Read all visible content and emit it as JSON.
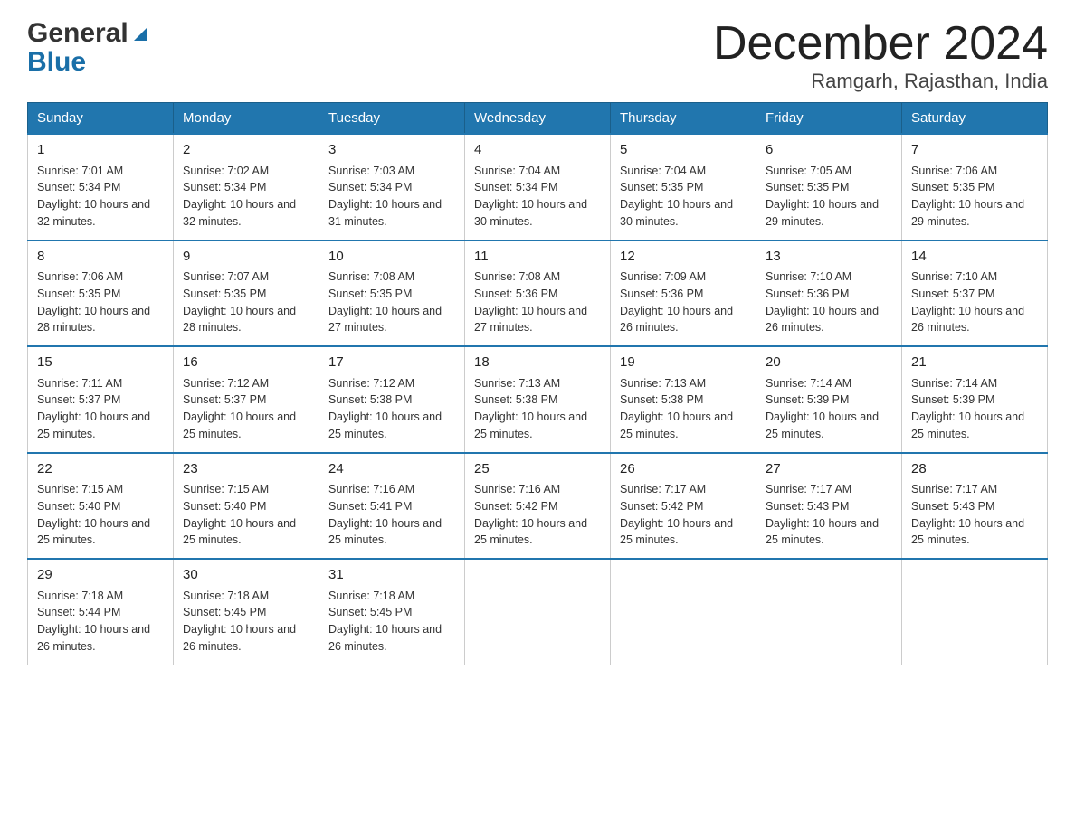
{
  "header": {
    "logo_general": "General",
    "logo_blue": "Blue",
    "title": "December 2024",
    "subtitle": "Ramgarh, Rajasthan, India"
  },
  "weekdays": [
    "Sunday",
    "Monday",
    "Tuesday",
    "Wednesday",
    "Thursday",
    "Friday",
    "Saturday"
  ],
  "weeks": [
    [
      {
        "day": "1",
        "sunrise": "7:01 AM",
        "sunset": "5:34 PM",
        "daylight": "10 hours and 32 minutes."
      },
      {
        "day": "2",
        "sunrise": "7:02 AM",
        "sunset": "5:34 PM",
        "daylight": "10 hours and 32 minutes."
      },
      {
        "day": "3",
        "sunrise": "7:03 AM",
        "sunset": "5:34 PM",
        "daylight": "10 hours and 31 minutes."
      },
      {
        "day": "4",
        "sunrise": "7:04 AM",
        "sunset": "5:34 PM",
        "daylight": "10 hours and 30 minutes."
      },
      {
        "day": "5",
        "sunrise": "7:04 AM",
        "sunset": "5:35 PM",
        "daylight": "10 hours and 30 minutes."
      },
      {
        "day": "6",
        "sunrise": "7:05 AM",
        "sunset": "5:35 PM",
        "daylight": "10 hours and 29 minutes."
      },
      {
        "day": "7",
        "sunrise": "7:06 AM",
        "sunset": "5:35 PM",
        "daylight": "10 hours and 29 minutes."
      }
    ],
    [
      {
        "day": "8",
        "sunrise": "7:06 AM",
        "sunset": "5:35 PM",
        "daylight": "10 hours and 28 minutes."
      },
      {
        "day": "9",
        "sunrise": "7:07 AM",
        "sunset": "5:35 PM",
        "daylight": "10 hours and 28 minutes."
      },
      {
        "day": "10",
        "sunrise": "7:08 AM",
        "sunset": "5:35 PM",
        "daylight": "10 hours and 27 minutes."
      },
      {
        "day": "11",
        "sunrise": "7:08 AM",
        "sunset": "5:36 PM",
        "daylight": "10 hours and 27 minutes."
      },
      {
        "day": "12",
        "sunrise": "7:09 AM",
        "sunset": "5:36 PM",
        "daylight": "10 hours and 26 minutes."
      },
      {
        "day": "13",
        "sunrise": "7:10 AM",
        "sunset": "5:36 PM",
        "daylight": "10 hours and 26 minutes."
      },
      {
        "day": "14",
        "sunrise": "7:10 AM",
        "sunset": "5:37 PM",
        "daylight": "10 hours and 26 minutes."
      }
    ],
    [
      {
        "day": "15",
        "sunrise": "7:11 AM",
        "sunset": "5:37 PM",
        "daylight": "10 hours and 25 minutes."
      },
      {
        "day": "16",
        "sunrise": "7:12 AM",
        "sunset": "5:37 PM",
        "daylight": "10 hours and 25 minutes."
      },
      {
        "day": "17",
        "sunrise": "7:12 AM",
        "sunset": "5:38 PM",
        "daylight": "10 hours and 25 minutes."
      },
      {
        "day": "18",
        "sunrise": "7:13 AM",
        "sunset": "5:38 PM",
        "daylight": "10 hours and 25 minutes."
      },
      {
        "day": "19",
        "sunrise": "7:13 AM",
        "sunset": "5:38 PM",
        "daylight": "10 hours and 25 minutes."
      },
      {
        "day": "20",
        "sunrise": "7:14 AM",
        "sunset": "5:39 PM",
        "daylight": "10 hours and 25 minutes."
      },
      {
        "day": "21",
        "sunrise": "7:14 AM",
        "sunset": "5:39 PM",
        "daylight": "10 hours and 25 minutes."
      }
    ],
    [
      {
        "day": "22",
        "sunrise": "7:15 AM",
        "sunset": "5:40 PM",
        "daylight": "10 hours and 25 minutes."
      },
      {
        "day": "23",
        "sunrise": "7:15 AM",
        "sunset": "5:40 PM",
        "daylight": "10 hours and 25 minutes."
      },
      {
        "day": "24",
        "sunrise": "7:16 AM",
        "sunset": "5:41 PM",
        "daylight": "10 hours and 25 minutes."
      },
      {
        "day": "25",
        "sunrise": "7:16 AM",
        "sunset": "5:42 PM",
        "daylight": "10 hours and 25 minutes."
      },
      {
        "day": "26",
        "sunrise": "7:17 AM",
        "sunset": "5:42 PM",
        "daylight": "10 hours and 25 minutes."
      },
      {
        "day": "27",
        "sunrise": "7:17 AM",
        "sunset": "5:43 PM",
        "daylight": "10 hours and 25 minutes."
      },
      {
        "day": "28",
        "sunrise": "7:17 AM",
        "sunset": "5:43 PM",
        "daylight": "10 hours and 25 minutes."
      }
    ],
    [
      {
        "day": "29",
        "sunrise": "7:18 AM",
        "sunset": "5:44 PM",
        "daylight": "10 hours and 26 minutes."
      },
      {
        "day": "30",
        "sunrise": "7:18 AM",
        "sunset": "5:45 PM",
        "daylight": "10 hours and 26 minutes."
      },
      {
        "day": "31",
        "sunrise": "7:18 AM",
        "sunset": "5:45 PM",
        "daylight": "10 hours and 26 minutes."
      },
      null,
      null,
      null,
      null
    ]
  ]
}
